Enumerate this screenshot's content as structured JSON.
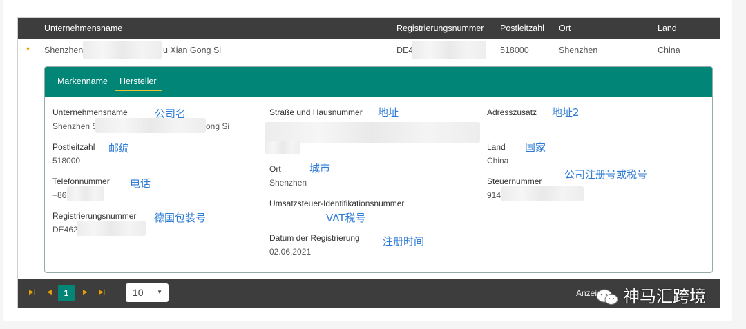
{
  "table": {
    "columns": [
      "Unternehmensname",
      "Registrierungsnummer",
      "Postleitzahl",
      "Ort",
      "Land"
    ],
    "row": {
      "company_prefix": "Shenzhen",
      "company_suffix": "u Xian Gong Si",
      "reg_prefix": "DE4",
      "postcode": "518000",
      "city": "Shenzhen",
      "country": "China"
    }
  },
  "detail": {
    "tabs": [
      "Markenname",
      "Hersteller"
    ],
    "active_tab": "Hersteller",
    "fields": {
      "company_label": "Unternehmensname",
      "company_prefix": "Shenzhen S",
      "company_suffix": "ong Si",
      "street_label": "Straße und Hausnummer",
      "address_extra_label": "Adresszusatz",
      "postcode_label": "Postleitzahl",
      "postcode_value": "518000",
      "country_label": "Land",
      "country_value": "China",
      "city_label": "Ort",
      "city_value": "Shenzhen",
      "phone_label": "Telefonnummer",
      "phone_prefix": "+86",
      "tax_label": "Steuernummer",
      "tax_prefix": "914",
      "vat_label": "Umsatzsteuer-Identifikationsnummer",
      "reg_label": "Registrierungsnummer",
      "reg_prefix": "DE462",
      "date_label": "Datum der Registrierung",
      "date_value": "02.06.2021"
    },
    "annotations": {
      "company": "公司名",
      "address": "地址",
      "address2": "地址2",
      "postcode": "邮编",
      "country": "国家",
      "city": "城市",
      "phone": "电话",
      "tax": "公司注册号或税号",
      "vat": "VAT税号",
      "reg": "德国包装号",
      "date": "注册时间"
    }
  },
  "pagination": {
    "current_page": "1",
    "page_size": "10",
    "summary": "Anzeig"
  },
  "watermark": "神马汇跨境",
  "colors": {
    "header": "#3d3d3d",
    "tab_bar": "#008577",
    "accent": "#e8a100",
    "annotation": "#2e7bd6"
  }
}
